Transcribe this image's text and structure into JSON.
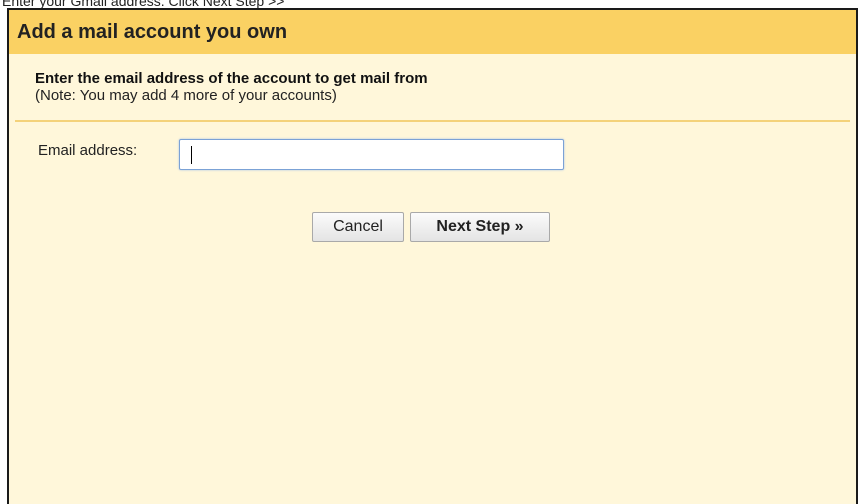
{
  "caption": "Enter your Gmail address. Click Next Step >>",
  "dialog": {
    "title": "Add a mail account you own",
    "heading": "Enter the email address of the account to get mail from",
    "note": "(Note: You may add 4 more of your accounts)",
    "email_label": "Email address:",
    "email_value": "",
    "email_placeholder": "",
    "cancel_label": "Cancel",
    "next_label": "Next Step »"
  },
  "colors": {
    "title_bar": "#fad163",
    "background": "#fff7da",
    "divider": "#f4d27a"
  }
}
